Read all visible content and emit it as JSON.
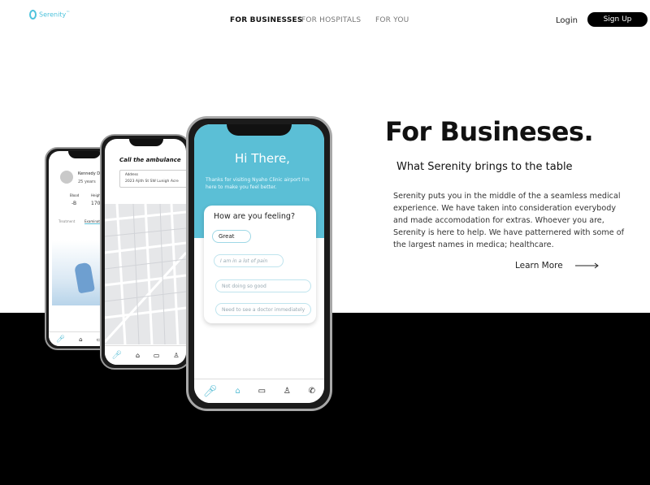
{
  "nav": {
    "logo_text": "Serenity",
    "logo_tm": "™",
    "links": [
      "FOR BUSINESSES",
      "FOR HOSPITALS",
      "FOR YOU"
    ],
    "login": "Login",
    "signup": "Sign Up"
  },
  "hero": {
    "title": "For Busineses.",
    "subtitle": "What Serenity brings to the table",
    "body": "Serenity puts you in the middle of the a seamless medical experience. We have taken into consideration everybody and made accomodation for extras. Whoever you are, Serenity is here to help. We have patternered with some of the largest names in medica; healthcare.",
    "learn_more": "Learn More"
  },
  "phone_left": {
    "name": "Kennedy D",
    "age": "25 years",
    "stat1_label": "Blood",
    "stat1_value": "-B",
    "stat2_label": "Height",
    "stat2_value": "170",
    "tab1": "Treatment",
    "tab2": "Examinat"
  },
  "phone_mid": {
    "title": "Call the ambulance",
    "address_label": "Address",
    "address_value": "2023 Ajith St SW Lunigh Acre"
  },
  "phone_front": {
    "greeting": "Hi There,",
    "intro": "Thanks for visiting Nyaho Clinic airport I'm here to make you feel better.",
    "question": "How are you feeling?",
    "options": [
      "Great",
      "I am in a lot of pain",
      "Not doing so good",
      "Need to see a doctor immediately"
    ]
  },
  "colors": {
    "accent": "#5bbfd6",
    "dark": "#000000"
  }
}
